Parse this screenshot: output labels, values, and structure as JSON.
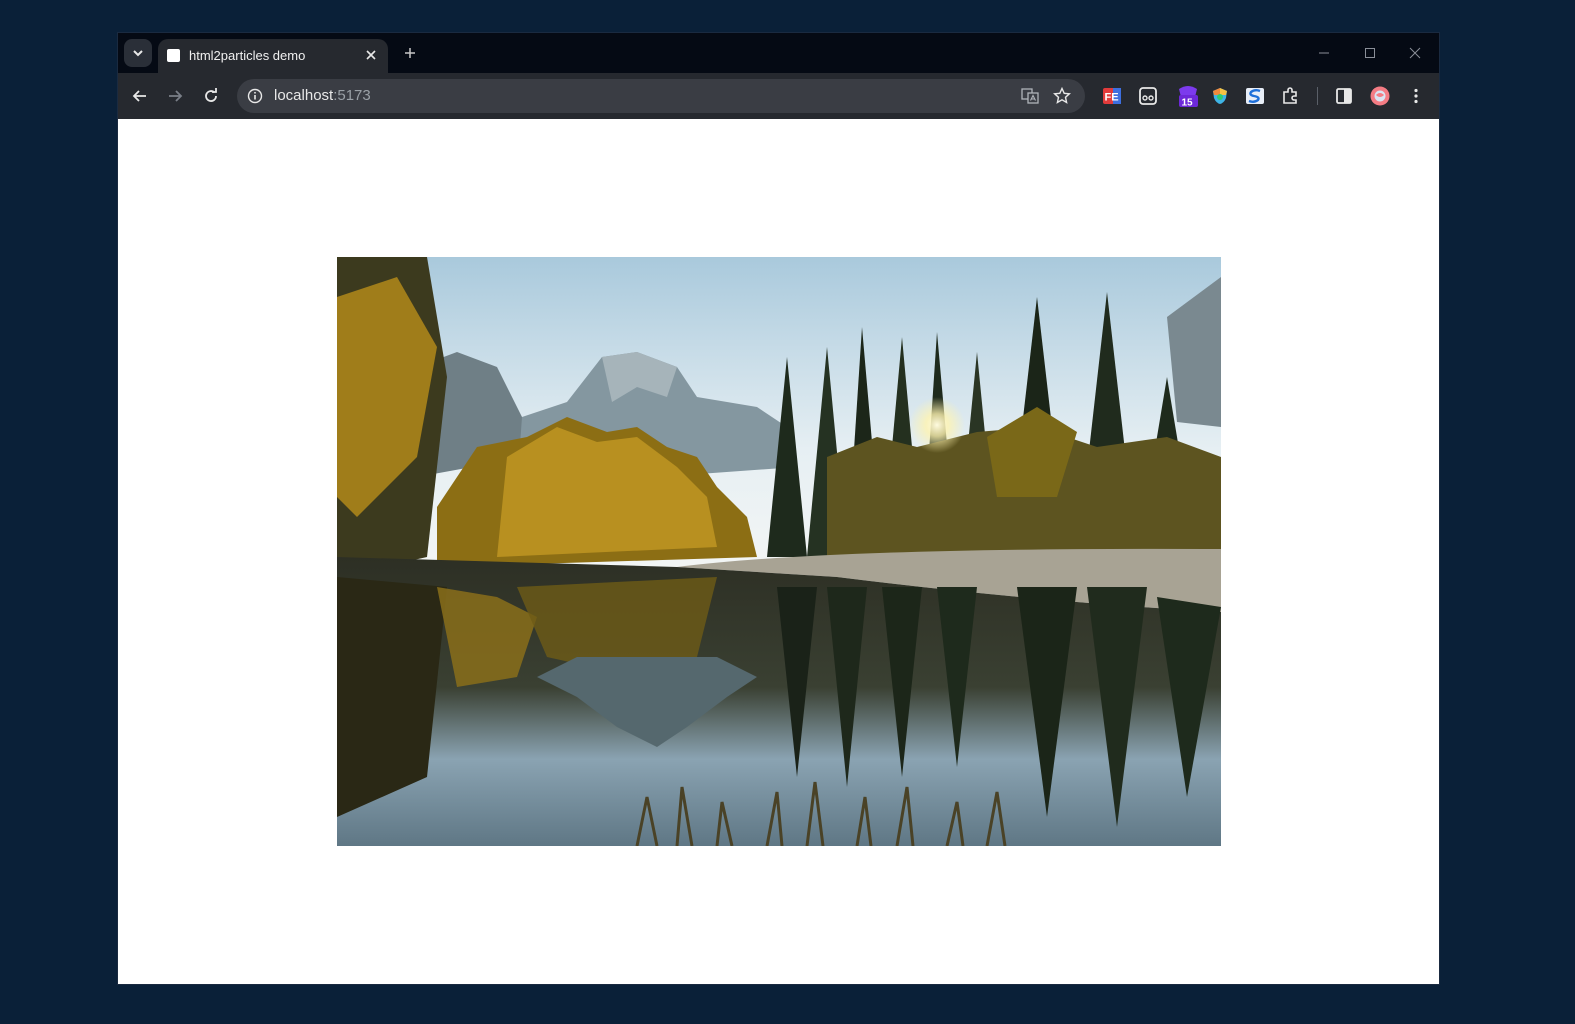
{
  "browser": {
    "tab": {
      "title": "html2particles demo"
    },
    "address": {
      "host": "localhost",
      "port": ":5173"
    },
    "extensions": [
      {
        "name": "fe-helper-icon",
        "label": "FE"
      },
      {
        "name": "reader-icon"
      },
      {
        "name": "calendar-badge-icon",
        "badge": "15"
      },
      {
        "name": "colorful-shield-icon"
      },
      {
        "name": "s-extension-icon",
        "label": "S"
      },
      {
        "name": "puzzle-icon"
      }
    ]
  },
  "colors": {
    "page_background": "#0a2038",
    "tabstrip": "#050a14",
    "toolbar": "#26292f",
    "omnibox": "#3a3d44",
    "content": "#ffffff"
  },
  "content": {
    "image_subject": "mountain-lake-landscape-photo"
  }
}
